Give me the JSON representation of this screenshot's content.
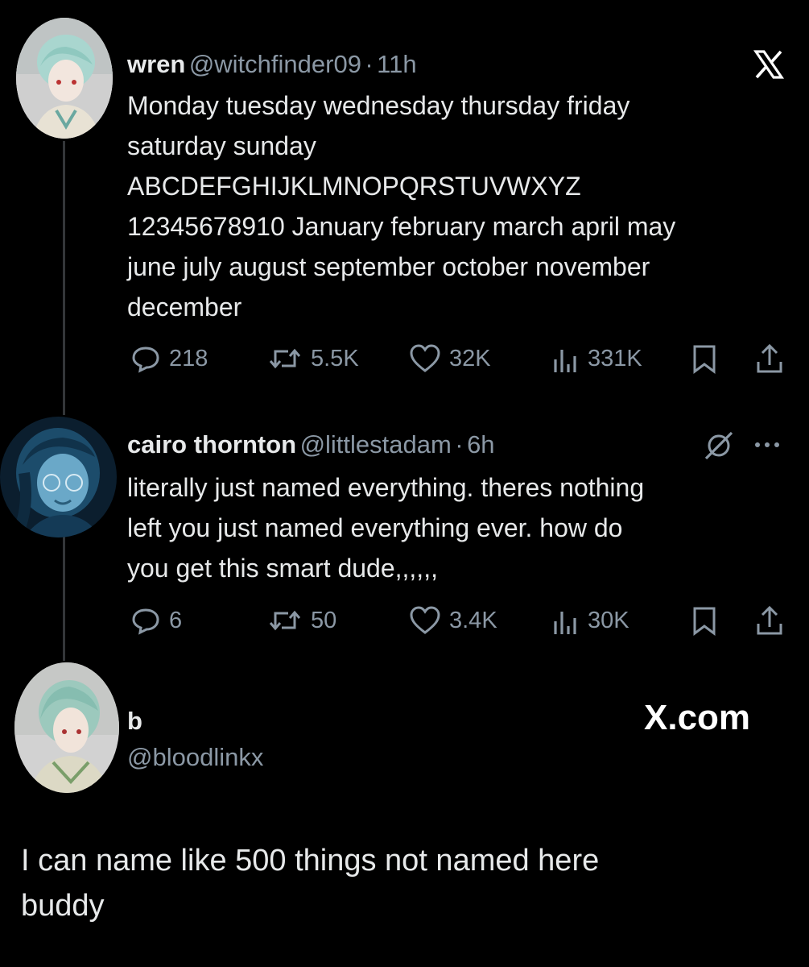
{
  "tweet1": {
    "name": "wren",
    "handle": "@witchfinder09",
    "separator": "·",
    "time": "11h",
    "lines": [
      "Monday tuesday wednesday thursday friday",
      "saturday sunday",
      "ABCDEFGHIJKLMNOPQRSTUVWXYZ",
      "12345678910 January february march april may",
      "june july august september october november",
      "december"
    ],
    "replies": "218",
    "reposts": "5.5K",
    "likes": "32K",
    "views": "331K"
  },
  "tweet2": {
    "name": "cairo thornton",
    "handle": "@littlestadam",
    "separator": "·",
    "time": "6h",
    "lines": [
      "literally just named everything. theres nothing",
      "left you just named everything ever. how do",
      "you get this smart dude,,,,,,"
    ],
    "replies": "6",
    "reposts": "50",
    "likes": "3.4K",
    "views": "30K"
  },
  "quote": {
    "name": "b",
    "handle": "@bloodlinkx",
    "brand": "X.com",
    "lines": [
      "I can name like 500 things not named here",
      "buddy"
    ]
  },
  "icons": {
    "x_logo": "x-logo-icon",
    "grok": "grok-icon",
    "more": "more-icon",
    "reply": "reply-icon",
    "repost": "repost-icon",
    "like": "like-icon",
    "views": "views-icon",
    "bookmark": "bookmark-icon",
    "share": "share-icon"
  },
  "colors": {
    "background": "#000000",
    "text": "#e7e9ea",
    "secondary": "#8b98a5",
    "thread_line": "#333639"
  }
}
